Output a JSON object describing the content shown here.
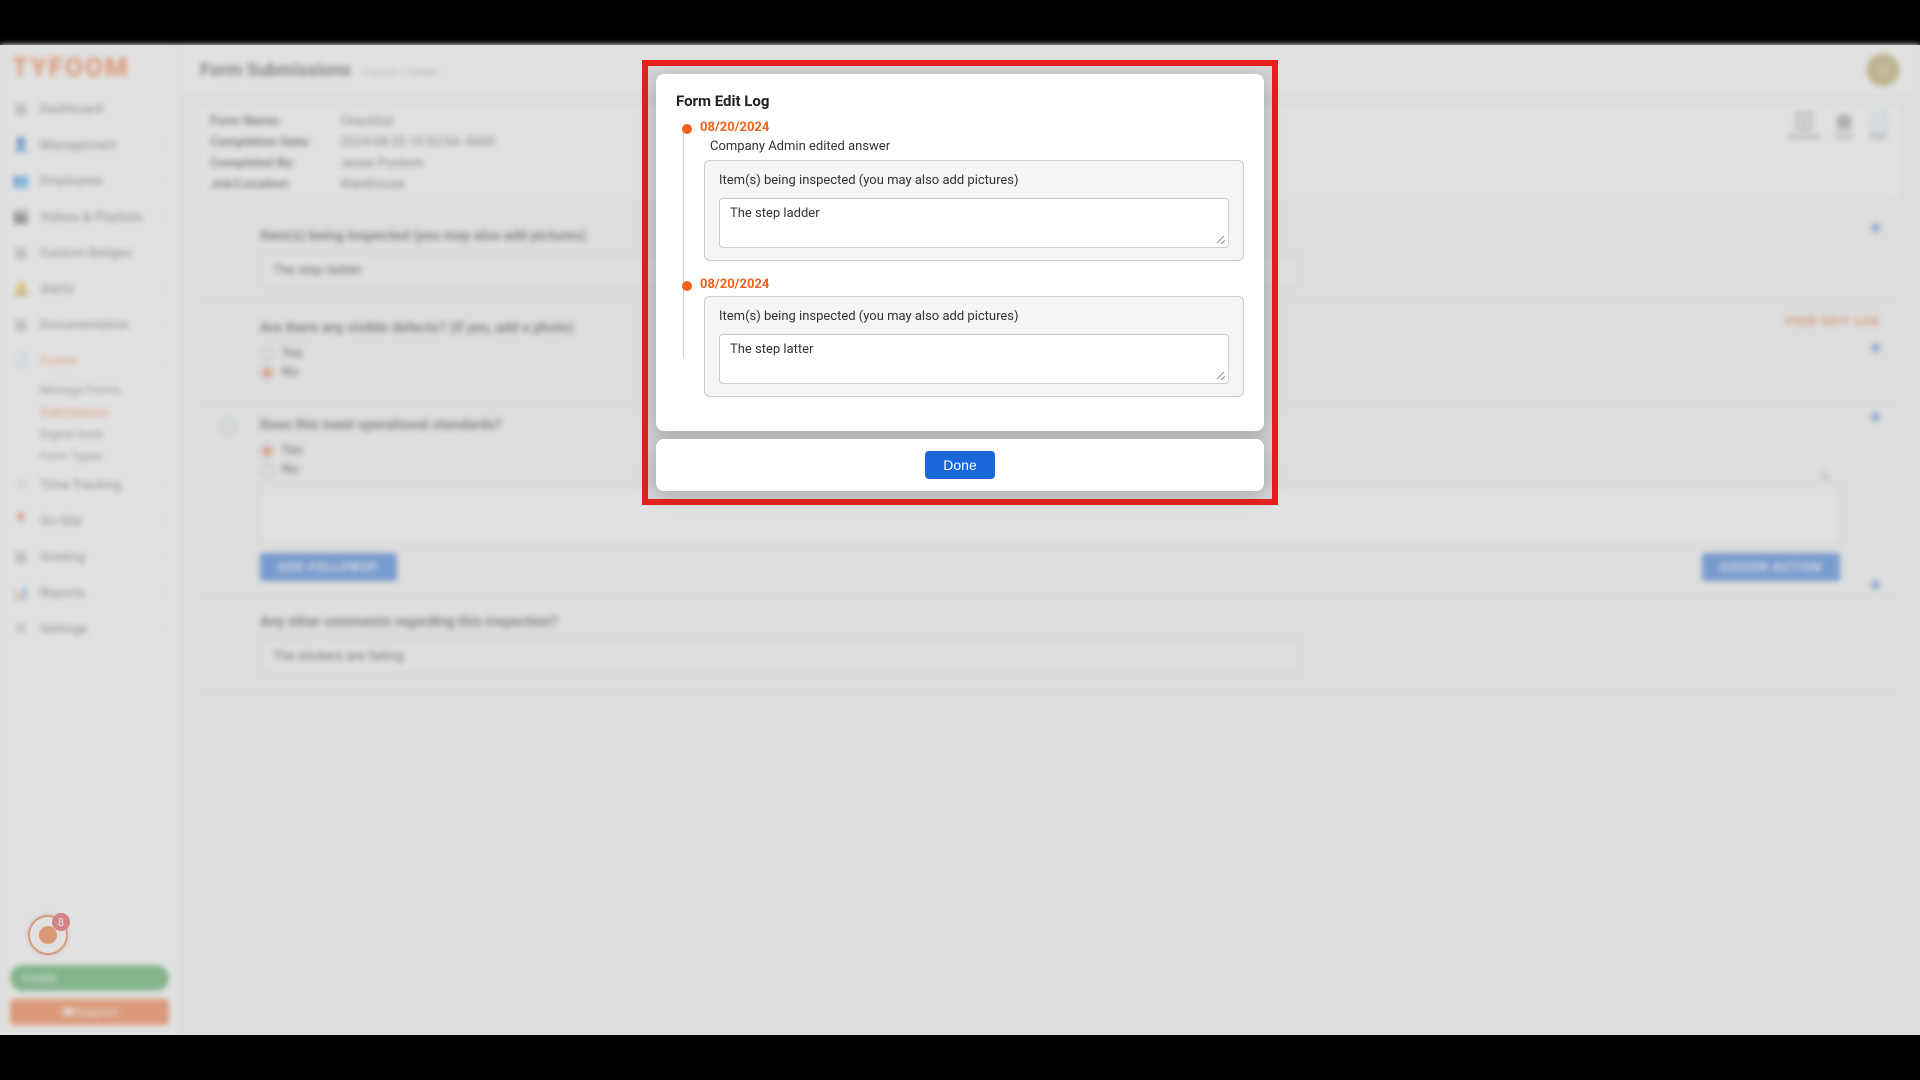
{
  "brand": "TYFOOM",
  "header": {
    "title": "Form Submissions",
    "breadcrumb": "Forms / Detail"
  },
  "sidebar": {
    "items": [
      {
        "icon": "▦",
        "label": "Dashboard",
        "expand": false
      },
      {
        "icon": "👤",
        "label": "Management",
        "expand": true
      },
      {
        "icon": "👥",
        "label": "Employees",
        "expand": true
      },
      {
        "icon": "🎬",
        "label": "Videos & Playlists",
        "expand": true
      },
      {
        "icon": "▦",
        "label": "Custom Badges",
        "expand": false
      },
      {
        "icon": "🔔",
        "label": "Alerts",
        "expand": true
      },
      {
        "icon": "▦",
        "label": "Documentation",
        "expand": true
      },
      {
        "icon": "📄",
        "label": "Forms",
        "expand": true,
        "active": true
      },
      {
        "icon": "⏱",
        "label": "Time Tracking",
        "expand": true
      },
      {
        "icon": "📍",
        "label": "On-Site",
        "expand": true
      },
      {
        "icon": "▦",
        "label": "Grading",
        "expand": true
      },
      {
        "icon": "📊",
        "label": "Reports",
        "expand": true
      },
      {
        "icon": "⚙",
        "label": "Settings",
        "expand": true
      }
    ],
    "formsSub": [
      {
        "label": "Manage Forms"
      },
      {
        "label": "Submissions",
        "active": true
      },
      {
        "label": "Digital Desk"
      },
      {
        "label": "Form Types"
      }
    ],
    "createBtn": "Create",
    "supportBtn": "Support",
    "recordBadge": "8"
  },
  "details": {
    "formName": {
      "label": "Form Name:",
      "value": "Checklist"
    },
    "completionDate": {
      "label": "Completion Date:",
      "value": "2024-08-20 10:52:04 -0600"
    },
    "completedBy": {
      "label": "Completed By:",
      "value": "Jesse Purdom"
    },
    "jobLocation": {
      "label": "Job/Location:",
      "value": "Warehouse"
    }
  },
  "actions": {
    "archive": "Archive",
    "csv": "CSV",
    "pdf": "PDF"
  },
  "questions": {
    "q1": {
      "title": "Item(s) being inspected (you may also add pictures)",
      "answer": "The step ladder"
    },
    "q2": {
      "title": "Are there any visible defects? (If yes, add a photo)",
      "yes": "Yes",
      "no": "No",
      "editLink": "VIEW EDIT LOG"
    },
    "q3": {
      "title": "Does this meet operational standards?",
      "yes": "Yes",
      "no": "No"
    },
    "addBtn": "ADD FOLLOWUP",
    "assignBtn": "ASSIGN ACTION",
    "q4": {
      "title": "Any other comments regarding this inspection?",
      "answer": "The stickers are failing"
    }
  },
  "modal": {
    "title": "Form Edit Log",
    "entries": [
      {
        "date": "08/20/2024",
        "desc": "Company Admin edited answer",
        "fieldLabel": "Item(s) being inspected (you may also add pictures)",
        "value": "The step ladder"
      },
      {
        "date": "08/20/2024",
        "desc": "",
        "fieldLabel": "Item(s) being inspected (you may also add pictures)",
        "value": "The step latter"
      }
    ],
    "done": "Done"
  }
}
